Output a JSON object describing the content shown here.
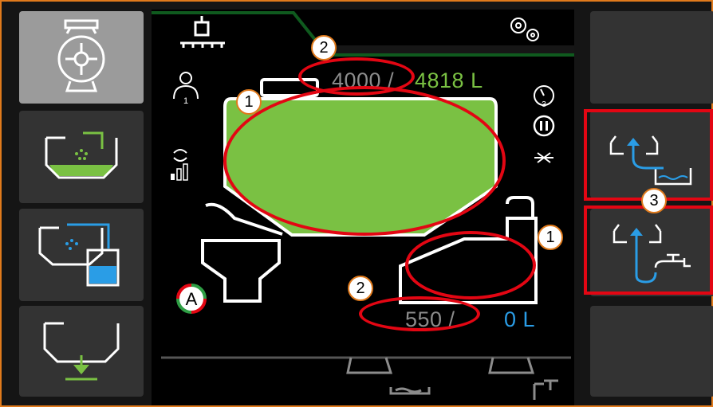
{
  "tank_main": {
    "current": "4000 /",
    "capacity": "4818 L",
    "fill_fraction": 1.0
  },
  "tank_secondary": {
    "current": "550 /",
    "capacity": "0 L"
  },
  "markers": {
    "main_tank_level": "1",
    "main_tank_readout": "2",
    "secondary_tank_level": "1",
    "secondary_tank_readout": "2",
    "right_buttons": "3"
  },
  "status": {
    "operator_number": "1",
    "program_number": "3",
    "auto_mode_letter": "A"
  },
  "colors": {
    "frame": "#e07a1c",
    "fill_green": "#7ac143",
    "water_blue": "#2a9de6",
    "annotation_red": "#e30613"
  },
  "icons": {
    "left_1": "pump-valve-icon",
    "left_2": "tank-rinse-icon",
    "left_3": "tank-transfer-icon",
    "left_4": "tank-drain-icon",
    "right_2": "fill-from-tank-icon",
    "right_3": "fill-from-tap-icon",
    "top": "sprayer-boom-icon",
    "settings": "gears-icon"
  }
}
